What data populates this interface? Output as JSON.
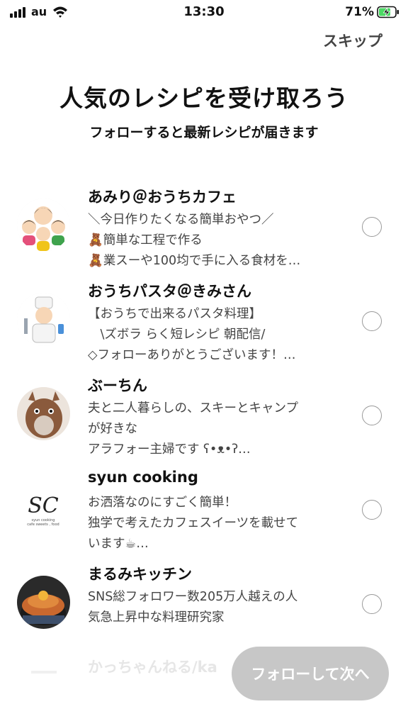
{
  "status_bar": {
    "carrier": "au",
    "time": "13:30",
    "battery": "71%"
  },
  "header": {
    "skip_label": "スキップ",
    "title": "人気のレシピを受け取ろう",
    "subtitle": "フォローすると最新レシピが届きます"
  },
  "users": [
    {
      "name": "あみり＠おうちカフェ",
      "lines": [
        "＼今日作りたくなる簡単おやつ／",
        "🧸簡単な工程で作る",
        "🧸業スーや100均で手に入る食材を…"
      ]
    },
    {
      "name": "おうちパスタ＠きみさん",
      "lines": [
        "【おうちで出来るパスタ料理】",
        "　\\ズボラ らく短レシピ 朝配信/",
        "◇フォローありがとうございます！…"
      ]
    },
    {
      "name": "ぶーちん",
      "lines": [
        "夫と二人暮らしの、スキーとキャンプ",
        "が好きな",
        "アラフォー主婦です ʕ•ᴥ•ʔ…"
      ]
    },
    {
      "name": "syun cooking",
      "lines": [
        "お洒落なのにすごく簡単！",
        "独学で考えたカフェスイーツを載せて",
        "います☕…"
      ]
    },
    {
      "name": "まるみキッチン",
      "lines": [
        "SNS総フォロワー数205万人越えの人",
        "気急上昇中な料理研究家"
      ]
    }
  ],
  "faded_user": {
    "name": "かっちゃんねる/ka"
  },
  "avatar_text": {
    "sc_logo": "SC",
    "sc_caption_1": "syun cooking",
    "sc_caption_2": "cafe sweets , food"
  },
  "footer": {
    "follow_next_label": "フォローして次へ"
  },
  "colors": {
    "button_disabled": "#c7c7c7",
    "battery_green": "#4cd964",
    "radio_border": "#9a9a9a"
  }
}
